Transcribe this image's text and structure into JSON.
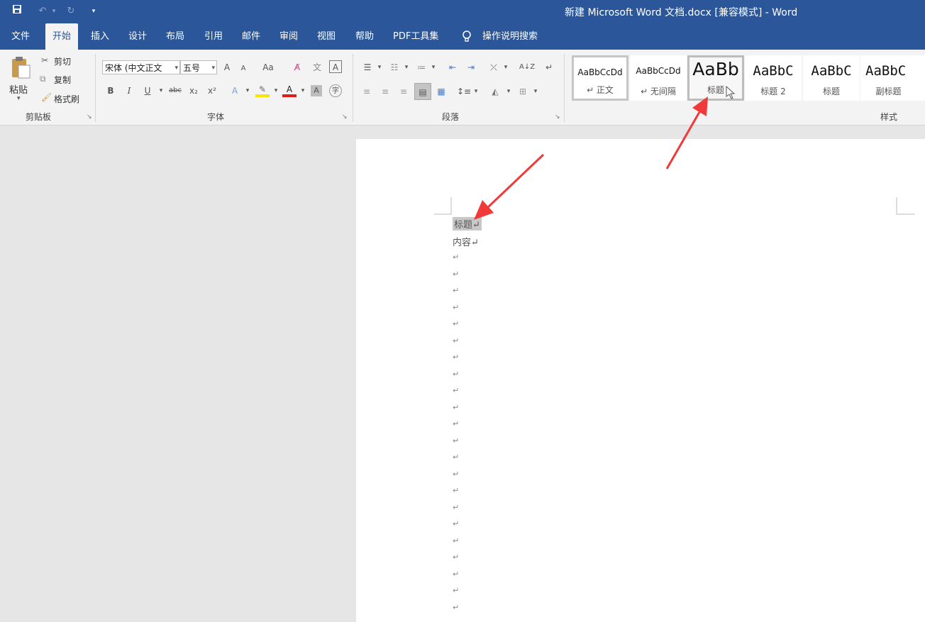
{
  "titlebar": {
    "qat": {
      "save_icon": "save-icon",
      "undo_icon": "undo-icon",
      "redo_icon": "redo-icon",
      "customize_icon": "qat-customize-icon"
    },
    "title": "新建 Microsoft Word 文档.docx [兼容模式]  -  Word"
  },
  "tabs": [
    "文件",
    "开始",
    "插入",
    "设计",
    "布局",
    "引用",
    "邮件",
    "审阅",
    "视图",
    "帮助",
    "PDF工具集"
  ],
  "tell_me": {
    "label": "操作说明搜索",
    "icon": "lightbulb-icon"
  },
  "clipboard": {
    "paste": "粘贴",
    "cut": "剪切",
    "copy": "复制",
    "format_painter": "格式刷",
    "group_label": "剪贴板"
  },
  "font": {
    "font_name": "宋体 (中文正文",
    "font_size": "五号",
    "group_label": "字体",
    "bold": "B",
    "italic": "I",
    "underline": "U",
    "strike": "abc",
    "subscript": "x₂",
    "superscript": "x²",
    "change_case": "Aa",
    "grow": "A",
    "shrink": "A",
    "font_color": "A"
  },
  "paragraph": {
    "group_label": "段落"
  },
  "styles": {
    "group_label": "样式",
    "items": [
      {
        "preview": "AaBbCcDd",
        "name": "↵ 正文"
      },
      {
        "preview": "AaBbCcDd",
        "name": "↵ 无间隔"
      },
      {
        "preview": "AaBb",
        "name": "标题"
      },
      {
        "preview": "AaBbC",
        "name": "标题 2"
      },
      {
        "preview": "AaBbC",
        "name": "标题"
      },
      {
        "preview": "AaBbC",
        "name": "副标题"
      }
    ]
  },
  "document": {
    "line1": "标题↵",
    "line2": "内容↵",
    "empty_mark": "↵"
  },
  "colors": {
    "brand": "#2b579a",
    "arrow": "#f03a3a",
    "selection": "#c8c8c8"
  }
}
